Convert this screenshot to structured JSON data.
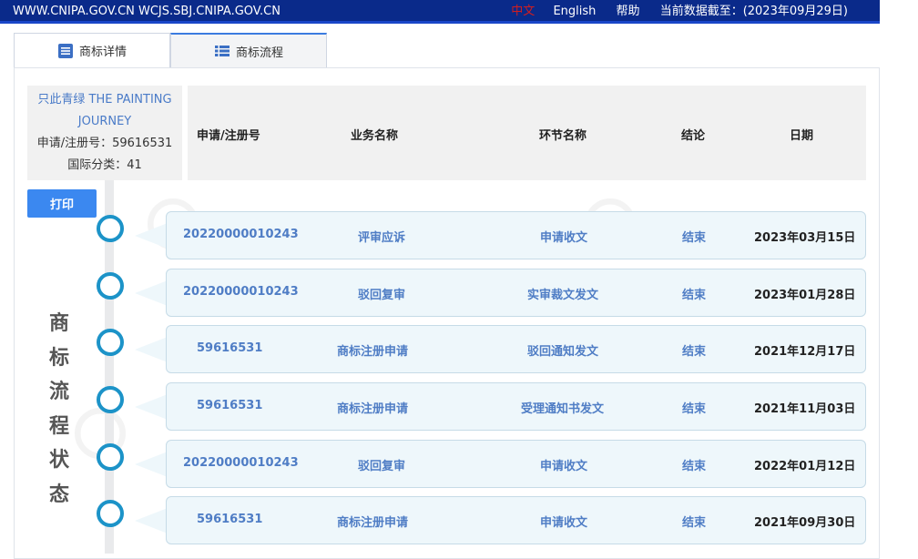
{
  "topbar": {
    "domains": "WWW.CNIPA.GOV.CN WCJS.SBJ.CNIPA.GOV.CN",
    "lang_zh": "中文",
    "lang_en": "English",
    "help": "帮助",
    "data_as_of": "当前数据截至：(2023年09月29日)"
  },
  "tabs": [
    {
      "label": "商标详情",
      "icon": "document-icon"
    },
    {
      "label": "商标流程",
      "icon": "list-icon"
    }
  ],
  "info": {
    "name": "只此青绿 THE PAINTING JOURNEY",
    "reg_no": "申请/注册号：59616531",
    "class": "国际分类：41"
  },
  "table": {
    "headers": [
      "申请/注册号",
      "业务名称",
      "环节名称",
      "结论",
      "日期"
    ]
  },
  "print_label": "打印",
  "side_title": [
    "商",
    "标",
    "流",
    "程",
    "状",
    "态"
  ],
  "rows": [
    {
      "reg": "20220000010243",
      "biz": "评审应诉",
      "step": "申请收文",
      "result": "结束",
      "date": "2023年03月15日"
    },
    {
      "reg": "20220000010243",
      "biz": "驳回复审",
      "step": "实审裁文发文",
      "result": "结束",
      "date": "2023年01月28日"
    },
    {
      "reg": "59616531",
      "biz": "商标注册申请",
      "step": "驳回通知发文",
      "result": "结束",
      "date": "2021年12月17日"
    },
    {
      "reg": "59616531",
      "biz": "商标注册申请",
      "step": "受理通知书发文",
      "result": "结束",
      "date": "2021年11月03日"
    },
    {
      "reg": "20220000010243",
      "biz": "驳回复审",
      "step": "申请收文",
      "result": "结束",
      "date": "2022年01月12日"
    },
    {
      "reg": "59616531",
      "biz": "商标注册申请",
      "step": "申请收文",
      "result": "结束",
      "date": "2021年09月30日"
    }
  ],
  "colors": {
    "accent": "#1c93c8",
    "link": "#4f7dc5",
    "topbar": "#0a2a8a",
    "button": "#3b88f0"
  }
}
